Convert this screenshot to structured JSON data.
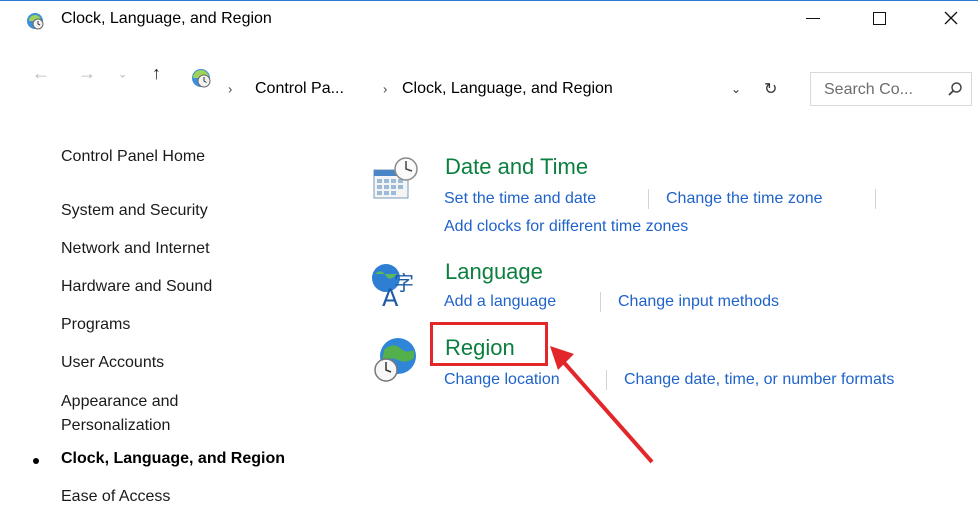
{
  "window": {
    "title": "Clock, Language, and Region",
    "min_icon": "minimize-icon",
    "max_icon": "maximize-icon",
    "close_icon": "close-icon",
    "close_glyph": "✕"
  },
  "address_bar": {
    "back_glyph": "←",
    "forward_glyph": "→",
    "recent_glyph": "⌄",
    "up_glyph": "↑",
    "separator_glyph": "›",
    "crumbs": [
      "Control Pa...",
      "Clock, Language, and Region"
    ],
    "dropdown_glyph": "⌄",
    "refresh_glyph": "↻",
    "search_placeholder": "Search Co..."
  },
  "sidebar": {
    "home": "Control Panel Home",
    "items": [
      "System and Security",
      "Network and Internet",
      "Hardware and Sound",
      "Programs",
      "User Accounts",
      "Appearance and Personalization",
      "Clock, Language, and Region",
      "Ease of Access"
    ],
    "active_index": 6
  },
  "categories": [
    {
      "title": "Date and Time",
      "icon": "calendar-clock-icon",
      "links": [
        "Set the time and date",
        "Change the time zone",
        "Add clocks for different time zones"
      ]
    },
    {
      "title": "Language",
      "icon": "language-icon",
      "links": [
        "Add a language",
        "Change input methods"
      ]
    },
    {
      "title": "Region",
      "icon": "globe-clock-icon",
      "links": [
        "Change location",
        "Change date, time, or number formats"
      ]
    }
  ],
  "annotation": {
    "highlight_color": "#e3262a",
    "target": "Region"
  },
  "colors": {
    "category_title": "#0b7f3f",
    "link": "#1f63c9",
    "top_border": "#2b7ad1"
  }
}
